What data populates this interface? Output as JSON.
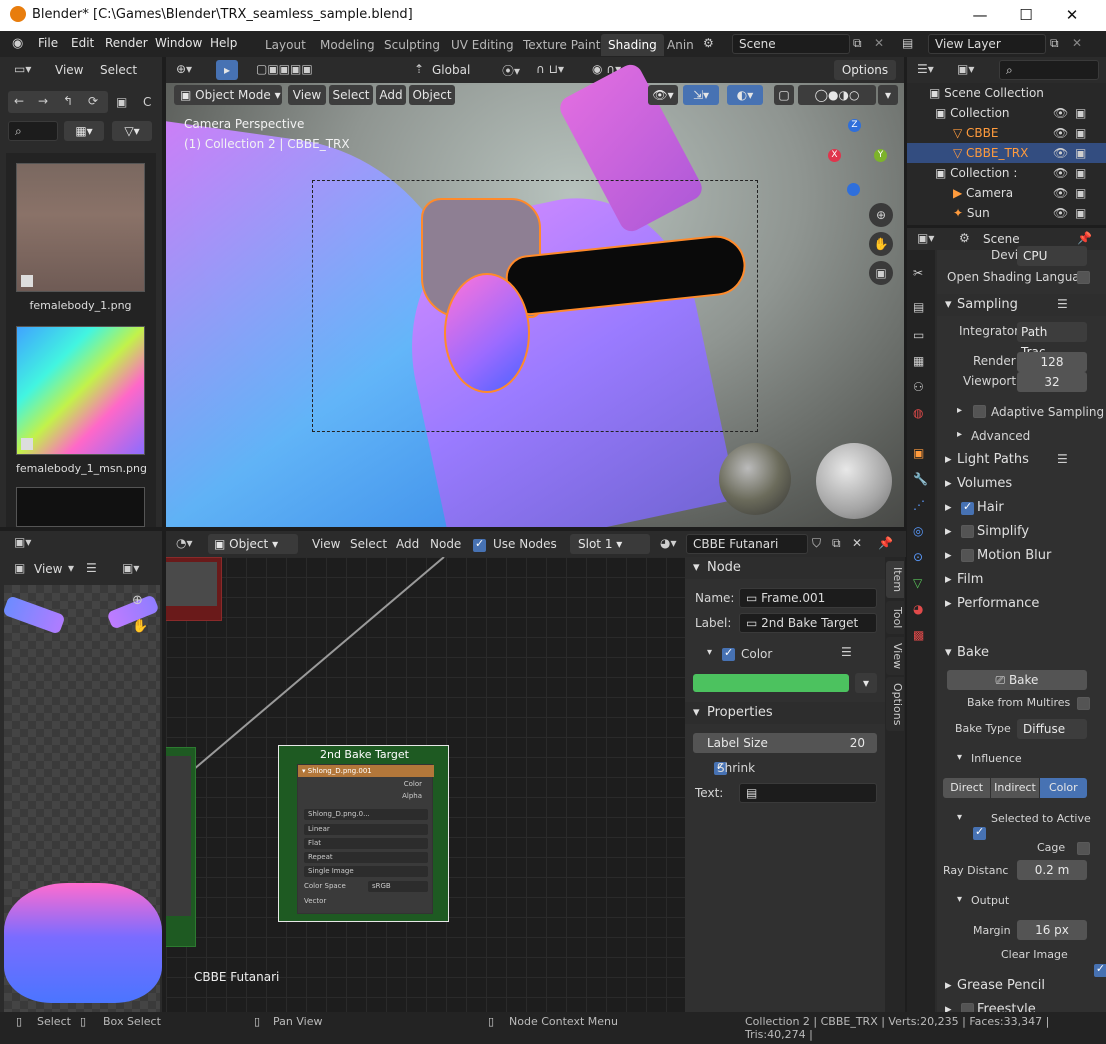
{
  "window": {
    "title": "Blender* [C:\\Games\\Blender\\TRX_seamless_sample.blend]",
    "minimize": "—",
    "maximize": "☐",
    "close": "✕"
  },
  "menubar": {
    "items": [
      "File",
      "Edit",
      "Render",
      "Window",
      "Help"
    ]
  },
  "workspaces": {
    "tabs": [
      "Layout",
      "Modeling",
      "Sculpting",
      "UV Editing",
      "Texture Paint",
      "Shading",
      "Anin"
    ],
    "active": "Shading"
  },
  "scene": {
    "label": "Scene",
    "view_layer": "View Layer"
  },
  "file_browser": {
    "view": "View",
    "select": "Select",
    "thumbs": [
      {
        "name": "femalebody_1.png"
      },
      {
        "name": "femalebody_1_msn.png"
      }
    ]
  },
  "viewport": {
    "mode": "Object Mode",
    "menus": [
      "View",
      "Select",
      "Add",
      "Object"
    ],
    "transform": "Global",
    "options": "Options",
    "overlay_line1": "Camera Perspective",
    "overlay_line2": "(1) Collection 2 | CBBE_TRX",
    "gizmo": {
      "x": "X",
      "y": "Y",
      "z": "Z"
    }
  },
  "outliner": {
    "root": "Scene Collection",
    "rows": [
      {
        "label": "Collection",
        "indent": 1,
        "type": "collection"
      },
      {
        "label": "CBBE",
        "indent": 2,
        "type": "mesh",
        "color": "#ff9b3d"
      },
      {
        "label": "CBBE_TRX",
        "indent": 2,
        "type": "mesh",
        "color": "#ff9b3d",
        "selected": true
      },
      {
        "label": "Collection :",
        "indent": 1,
        "type": "collection"
      },
      {
        "label": "Camera",
        "indent": 2,
        "type": "camera"
      },
      {
        "label": "Sun",
        "indent": 2,
        "type": "light"
      }
    ]
  },
  "properties": {
    "context": "Scene",
    "device_label": "Device",
    "device_value": "CPU",
    "osl_label": "Open Shading Langua...",
    "sampling": "Sampling",
    "integrator_label": "Integrator",
    "integrator_value": "Path Trac...",
    "render_label": "Render",
    "render_value": "128",
    "viewport_label": "Viewport",
    "viewport_value": "32",
    "adaptive": "Adaptive Sampling",
    "advanced": "Advanced",
    "light_paths": "Light Paths",
    "volumes": "Volumes",
    "hair": "Hair",
    "simplify": "Simplify",
    "motion_blur": "Motion Blur",
    "film": "Film",
    "performance": "Performance",
    "bake": "Bake",
    "bake_button": "Bake",
    "bake_multires": "Bake from Multires",
    "bake_type_label": "Bake Type",
    "bake_type_value": "Diffuse",
    "influence": "Influence",
    "direct": "Direct",
    "indirect": "Indirect",
    "color": "Color",
    "selected_to_active": "Selected to Active",
    "cage": "Cage",
    "ray_distance_label": "Ray Distanc",
    "ray_distance_value": "0.2 m",
    "output": "Output",
    "margin_label": "Margin",
    "margin_value": "16 px",
    "clear_image": "Clear Image",
    "grease_pencil": "Grease Pencil",
    "freestyle": "Freestyle"
  },
  "image_editor": {
    "view": "View"
  },
  "node_editor": {
    "object": "Object",
    "menus": [
      "View",
      "Select",
      "Add",
      "Node"
    ],
    "use_nodes": "Use Nodes",
    "slot": "Slot 1",
    "material": "CBBE Futanari",
    "material_label": "CBBE Futanari",
    "node_title": "2nd Bake Target",
    "node_image": "Shlong_D.png.001",
    "node_outputs": [
      "Color",
      "Alpha"
    ],
    "node_img_field": "Shlong_D.png.0...",
    "node_options": [
      "Linear",
      "Flat",
      "Repeat",
      "Single Image"
    ],
    "color_space_label": "Color Space",
    "color_space_value": "sRGB",
    "vector": "Vector"
  },
  "sidebar": {
    "node_section": "Node",
    "name_label": "Name:",
    "name_value": "Frame.001",
    "label_label": "Label:",
    "label_value": "2nd Bake Target",
    "color_label": "Color",
    "color_value": "#4cc25f",
    "properties_section": "Properties",
    "label_size_label": "Label Size",
    "label_size_value": "20",
    "shrink": "Shrink",
    "text_label": "Text:",
    "tabs": [
      "Item",
      "Tool",
      "View",
      "Options"
    ]
  },
  "statusbar": {
    "select": "Select",
    "box_select": "Box Select",
    "pan_view": "Pan View",
    "context_menu": "Node Context Menu",
    "stats": "Collection 2 | CBBE_TRX | Verts:20,235 | Faces:33,347 | Tris:40,274 |"
  }
}
